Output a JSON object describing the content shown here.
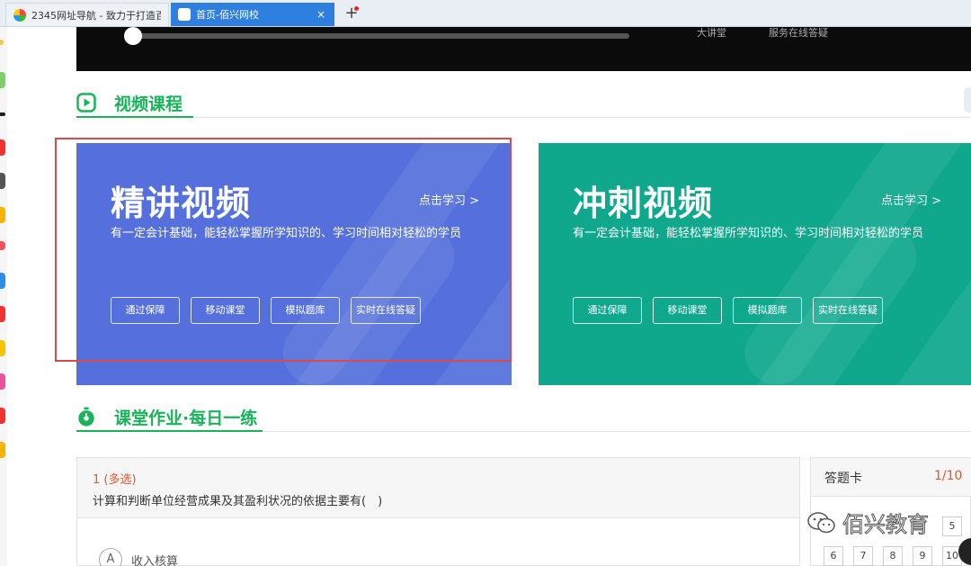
{
  "browser": {
    "tabs": [
      {
        "label": "2345网址导航 - 致力于打造百",
        "active": false
      },
      {
        "label": "首页-佰兴网校",
        "active": true,
        "close": "×"
      }
    ],
    "new_tab": "+"
  },
  "player": {
    "progress": 0.02,
    "overlay_text_1": "大讲堂",
    "overlay_text_2": "服务在线答疑"
  },
  "video_section": {
    "title": "视频课程",
    "cards": [
      {
        "title": "精讲视频",
        "link": "点击学习 >",
        "description": "有一定会计基础，能轻松掌握所学知识的、学习时间相对轻松的学员",
        "tags": [
          "通过保障",
          "移动课堂",
          "模拟题库",
          "实时在线答疑"
        ],
        "color": "#5570dc"
      },
      {
        "title": "冲刺视频",
        "link": "点击学习 >",
        "description": "有一定会计基础，能轻松掌握所学知识的、学习时间相对轻松的学员",
        "tags": [
          "通过保障",
          "移动课堂",
          "模拟题库",
          "实时在线答疑"
        ],
        "color": "#0fa88d"
      }
    ]
  },
  "practice_section": {
    "title": "课堂作业·每日一练"
  },
  "question": {
    "number": "1 (多选)",
    "text": "计算和判断单位经营成果及其盈利状况的依据主要有(　)",
    "option_letter": "A",
    "option_text": "收入核算"
  },
  "answer_card": {
    "title": "答题卡",
    "count": "1/10",
    "numbers": [
      "5",
      "6",
      "7",
      "8",
      "9",
      "10"
    ]
  },
  "watermark": "佰兴教育",
  "colors": {
    "accent_green": "#19b35a",
    "highlight_red": "#e04848",
    "question_orange": "#e4572e"
  }
}
